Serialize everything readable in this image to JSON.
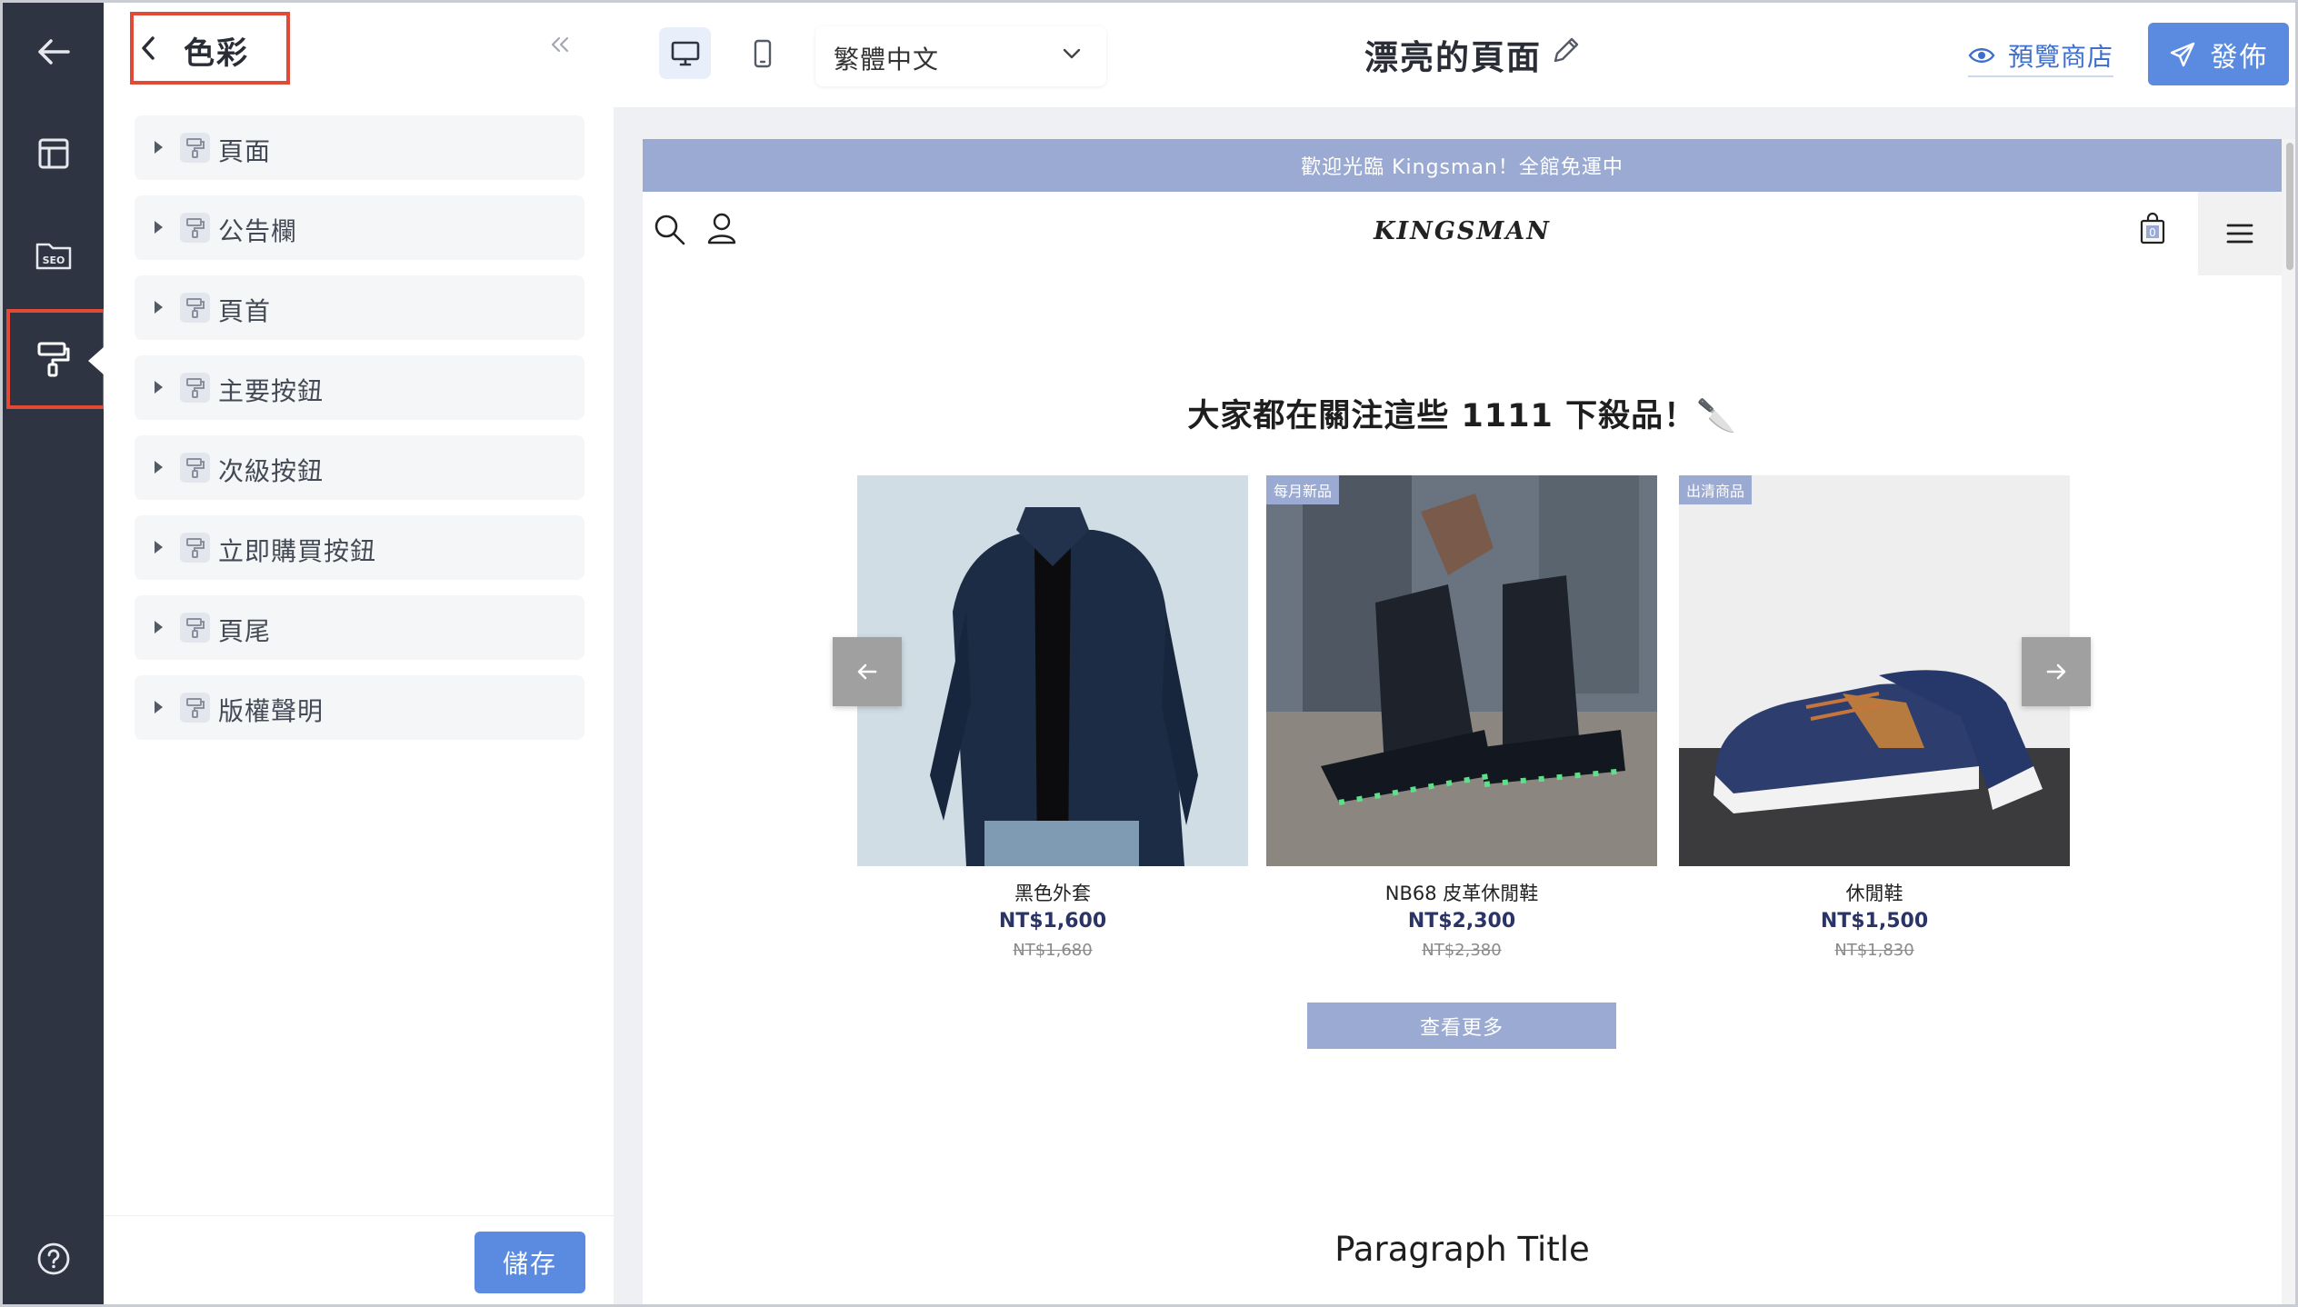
{
  "panel": {
    "title": "色彩",
    "items": [
      {
        "label": "頁面"
      },
      {
        "label": "公告欄"
      },
      {
        "label": "頁首"
      },
      {
        "label": "主要按鈕"
      },
      {
        "label": "次級按鈕"
      },
      {
        "label": "立即購買按鈕"
      },
      {
        "label": "頁尾"
      },
      {
        "label": "版權聲明"
      }
    ],
    "save_label": "儲存"
  },
  "rail": {
    "items": [
      {
        "icon": "arrow-left-icon"
      },
      {
        "icon": "layout-icon"
      },
      {
        "icon": "seo-folder-icon",
        "text": "SEO"
      },
      {
        "icon": "paint-roller-icon",
        "active": true
      },
      {
        "icon": "help-icon"
      }
    ]
  },
  "topbar": {
    "language": "繁體中文",
    "page_title": "漂亮的頁面",
    "preview_label": "預覽商店",
    "publish_label": "發佈"
  },
  "store": {
    "announcement": "歡迎光臨 Kingsman！全館免運中",
    "brand": "KINGSMAN",
    "cart_count": "0",
    "section_title": "大家都在關注這些 1111 下殺品！🔪",
    "products": [
      {
        "name": "黑色外套",
        "price": "NT$1,600",
        "original_price": "NT$1,680",
        "tag": ""
      },
      {
        "name": "NB68 皮革休閒鞋",
        "price": "NT$2,300",
        "original_price": "NT$2,380",
        "tag": "每月新品"
      },
      {
        "name": "休閒鞋",
        "price": "NT$1,500",
        "original_price": "NT$1,830",
        "tag": "出清商品"
      }
    ],
    "more_label": "查看更多",
    "paragraph_title": "Paragraph Title"
  },
  "colors": {
    "rail_bg": "#2f3443",
    "highlight": "#e04a36",
    "primary": "#5b8be0",
    "accent_store": "#9aaad2",
    "price": "#2a3466"
  }
}
